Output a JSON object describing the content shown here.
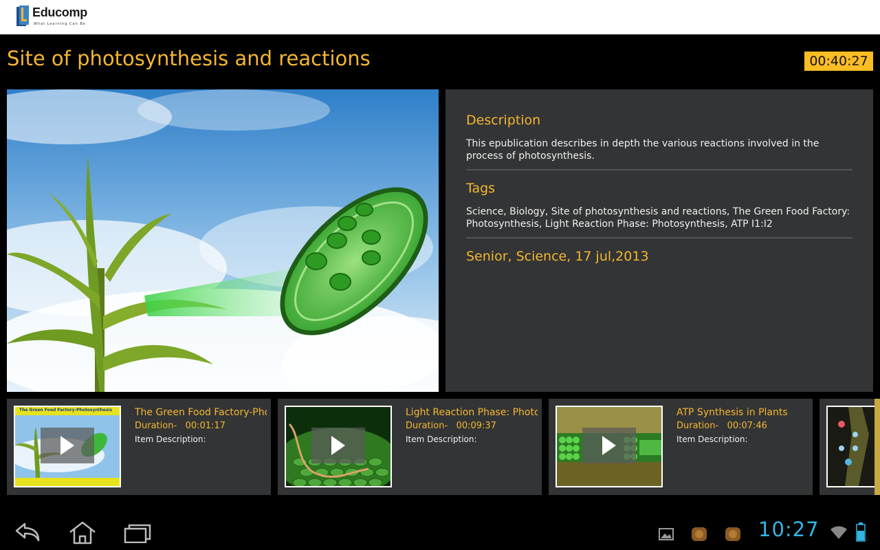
{
  "app": {
    "logo_text": "Educomp",
    "logo_tagline": "What  Learning  Can  Be"
  },
  "page": {
    "title": "Site of photosynthesis and reactions",
    "timer": "00:40:27"
  },
  "info": {
    "description_heading": "Description",
    "description_text": "This epublication describes in depth the various reactions involved in the process of photosynthesis.",
    "tags_heading": "Tags",
    "tags_text": "Science, Biology, Site of photosynthesis and reactions, The Green Food Factory: Photosynthesis, Light Reaction Phase: Photosynthesis, ATP I1:I2",
    "meta": "Senior, Science, 17 jul,2013"
  },
  "items": [
    {
      "title": "The Green Food Factory-Photosynthesis",
      "duration_label": "Duration-",
      "duration": "00:01:17",
      "desc_label": "Item Description:",
      "thumb_caption": "The Green Food Factory-Photosynthesis"
    },
    {
      "title": "Light Reaction Phase: Photosynthesis",
      "duration_label": "Duration-",
      "duration": "00:09:37",
      "desc_label": "Item Description:"
    },
    {
      "title": "ATP Synthesis in Plants",
      "duration_label": "Duration-",
      "duration": "00:07:46",
      "desc_label": "Item Description:"
    }
  ],
  "system": {
    "clock": "10:27"
  },
  "colors": {
    "accent": "#f5b731",
    "panel": "#333435",
    "clock": "#33b5e5"
  }
}
